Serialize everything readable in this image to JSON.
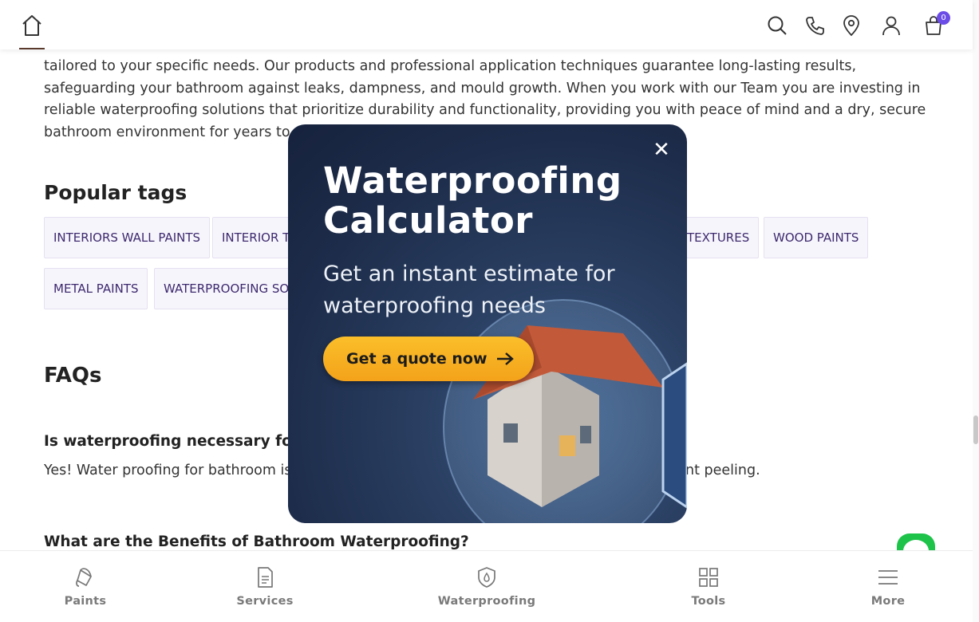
{
  "header": {
    "cart_count": "0"
  },
  "content": {
    "para_lines": [
      "tailored to your specific needs. Our products and professional application techniques guarantee long-lasting results,",
      "safeguarding your bathroom against leaks, dampness, and mould growth. When you work with our Team you are investing in",
      "reliable waterproofing solutions that prioritize durability and functionality, providing you with peace of mind and a dry, secure",
      "bathroom environment for years to c"
    ],
    "popular_tags_title": "Popular tags",
    "tags": [
      "INTERIORS WALL PAINTS",
      "INTERIOR TE",
      "TEXTURES",
      "WOOD PAINTS",
      "METAL PAINTS",
      "WATERPROOFING SOL"
    ],
    "faqs_title": "FAQs",
    "faqs": [
      {
        "q": "Is waterproofing necessary for t",
        "a_left": "Yes! Water proofing for bathroom is",
        "a_right": "nt peeling."
      },
      {
        "q": "What are the Benefits of Bathroom Waterproofing?"
      }
    ]
  },
  "popup": {
    "title": "Waterproofing Calculator",
    "title_line1": "Waterproofing",
    "title_line2": "Calculator",
    "subtitle_line1": "Get an instant estimate for",
    "subtitle_line2": "waterproofing needs",
    "cta_label": "Get a quote now",
    "close_glyph": "✕"
  },
  "bottom_nav": {
    "items": [
      {
        "label": "Paints",
        "icon": "paint-bucket-icon"
      },
      {
        "label": "Services",
        "icon": "document-icon"
      },
      {
        "label": "Waterproofing",
        "icon": "shield-drop-icon"
      },
      {
        "label": "Tools",
        "icon": "grid-icon"
      },
      {
        "label": "More",
        "icon": "menu-icon"
      }
    ]
  },
  "colors": {
    "accent": "#6c4ce6",
    "tag_text": "#3d2a6e",
    "cta": "#f7b224",
    "popup_bg": "#1d2c4a",
    "chat": "#1ec34a"
  }
}
